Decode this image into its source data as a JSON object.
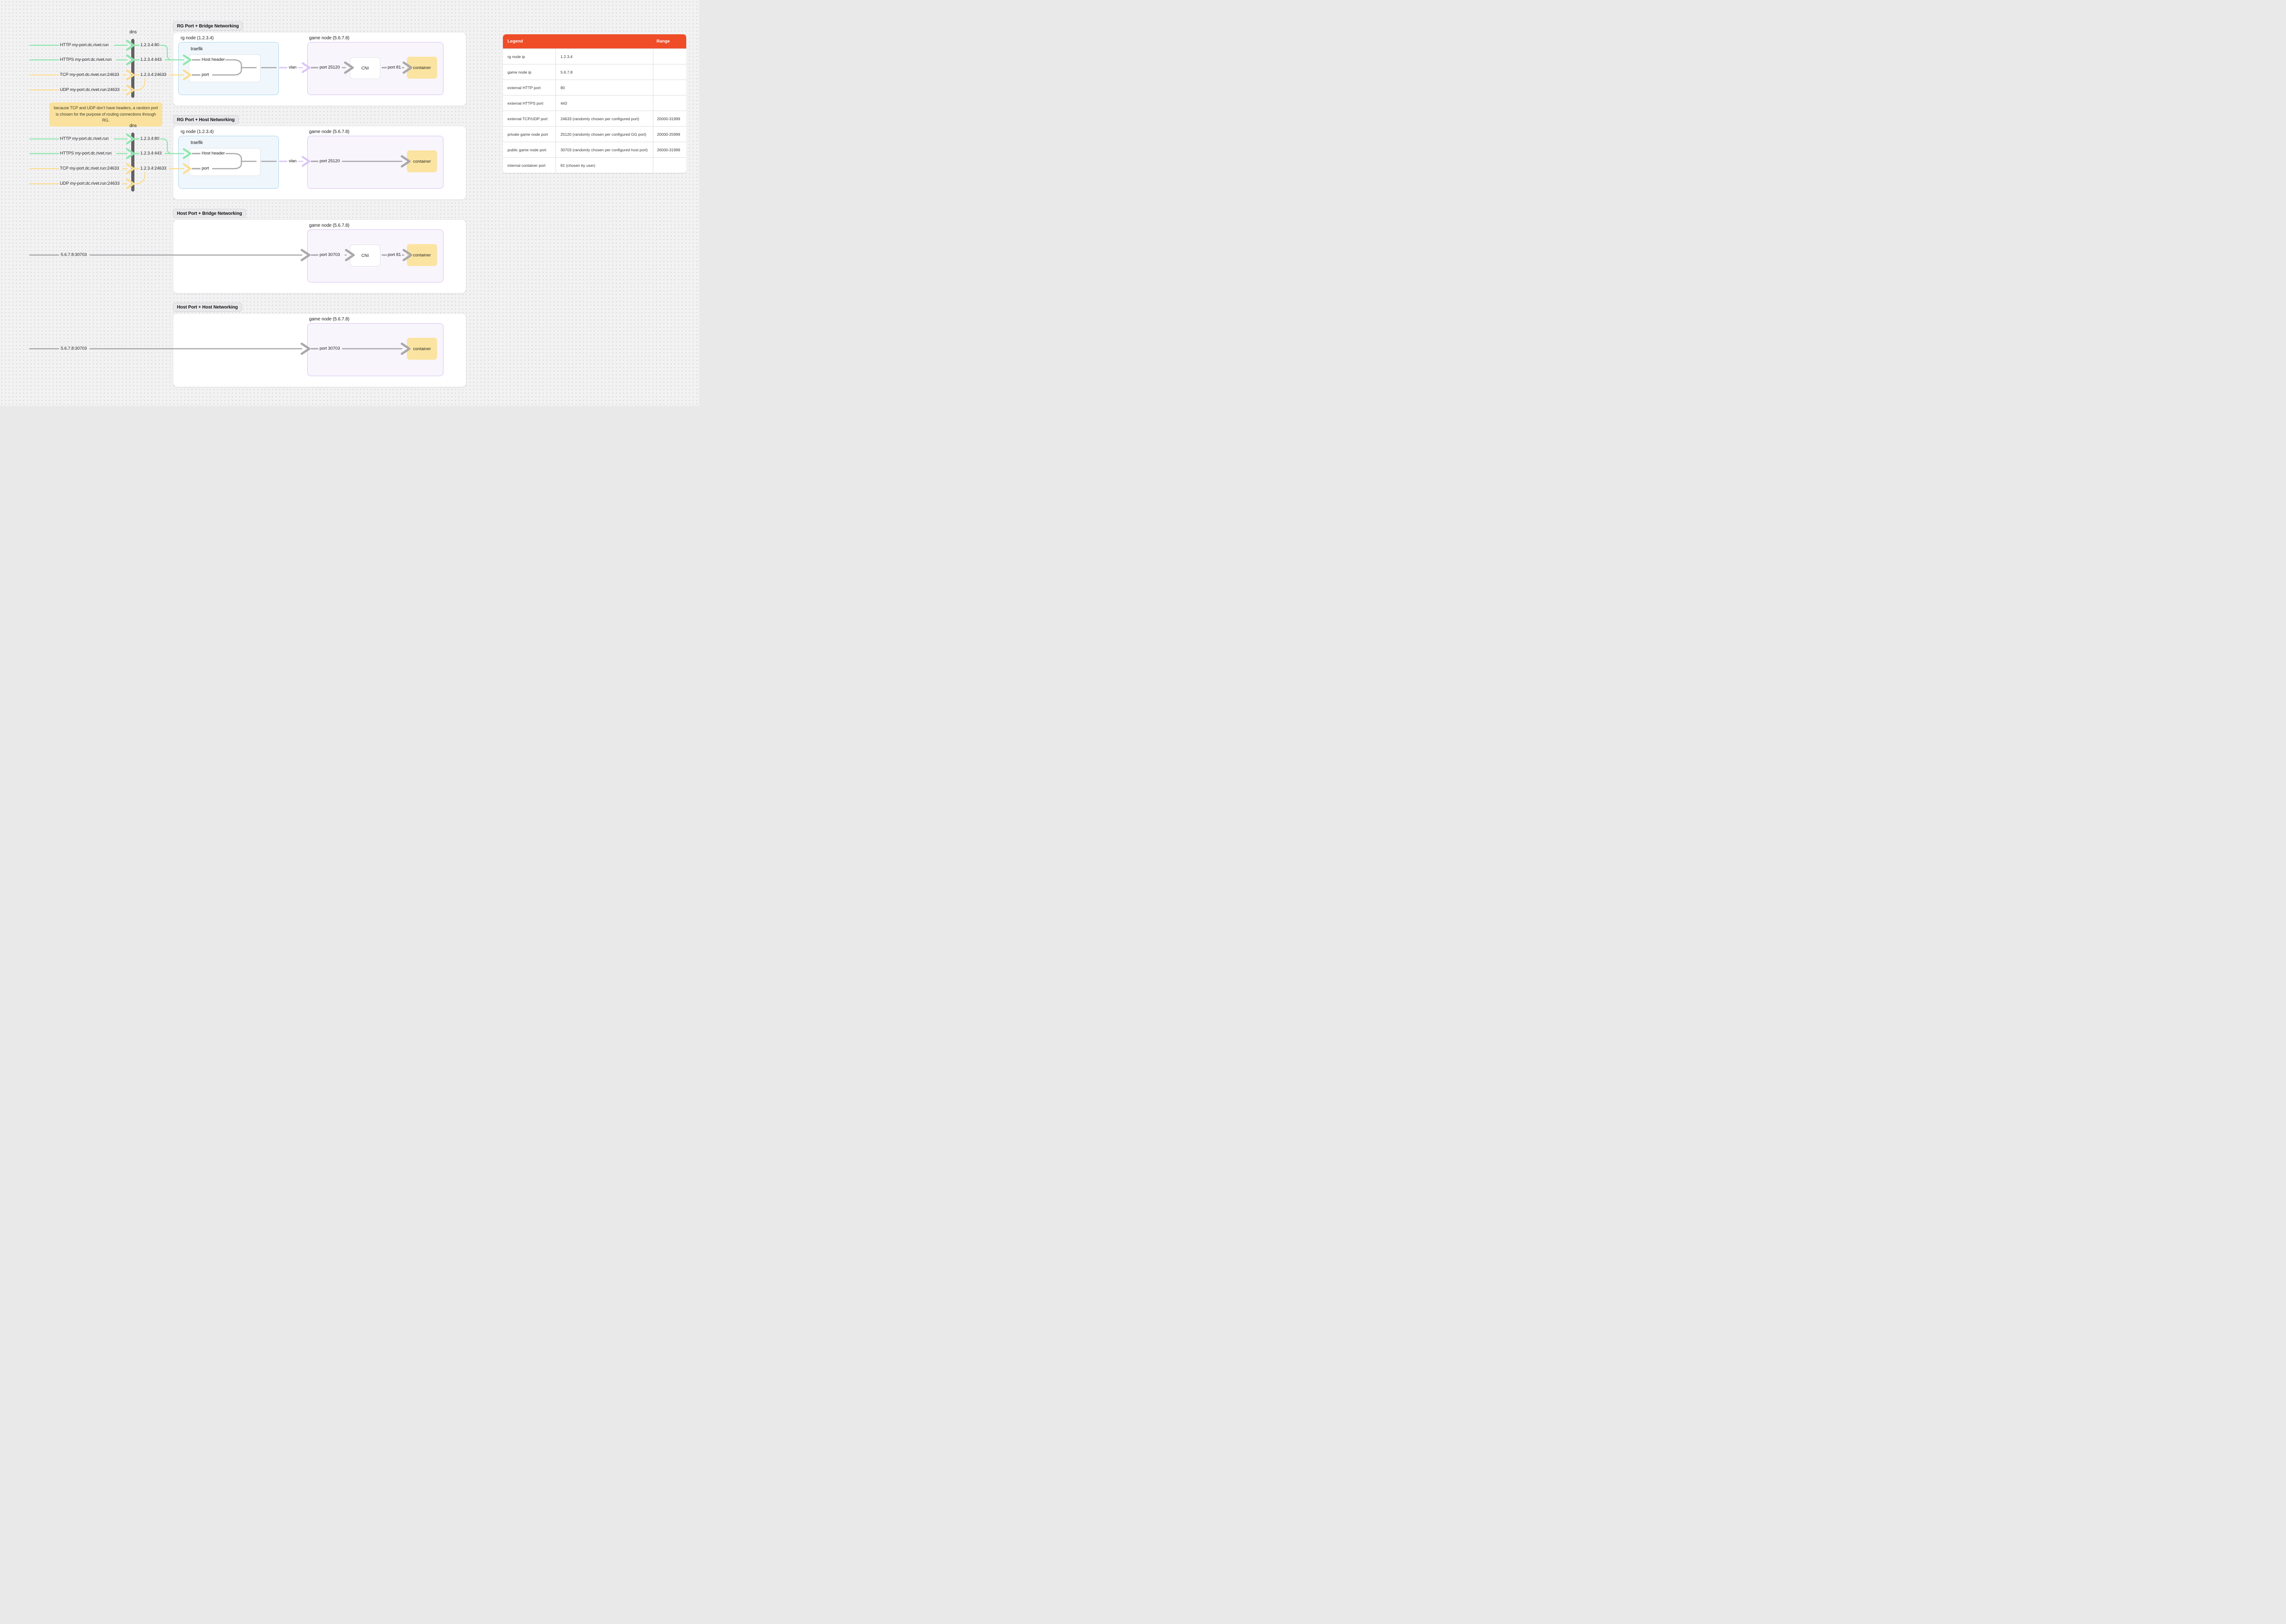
{
  "colors": {
    "background": "#F2F2F3",
    "accent_orange": "#EE4D28",
    "green_arrow": "#8FE7AE",
    "yellow_arrow": "#FBDD90",
    "purple_arrow": "#DBC6F6",
    "gray_arrow": "#A9A9AC",
    "rg_node_blue": "#A9D5F0",
    "game_node_purple": "#D8C2F2",
    "container_yellow": "#FBE4A1",
    "note_yellow": "#FAE29E"
  },
  "dns": {
    "label": "dns",
    "inputs": [
      "HTTP my-port.dc.rivet.run",
      "HTTPS my-port.dc.rivet.run",
      "TCP my-port.dc.rivet.run:24633",
      "UDP my-port.dc.rivet.run:24633"
    ],
    "outputs": [
      "1.2.3.4:80",
      "1.2.3.4:443",
      "1.2.3.4:24633"
    ]
  },
  "note": "because TCP and UDP don’t have headers, a random port is chosen for the purpose of routing connections through RG.",
  "sections": [
    {
      "title": "RG Port + Bridge Networking"
    },
    {
      "title": "RG Port + Host Networking"
    },
    {
      "title": "Host Port + Bridge Networking"
    },
    {
      "title": "Host Port + Host Networking"
    }
  ],
  "nodes": {
    "rg_node": "rg node (1.2.3.4)",
    "game_node": "game node (5.6.7.8)",
    "traefik": "traefik",
    "host_header": "Host header",
    "port": "port",
    "vlan": "vlan",
    "cni": "CNI",
    "container": "container",
    "port_private": "port 25120",
    "port_public": "port 30703",
    "port_internal": "port 81",
    "host_address": "5.6.7.8:30703"
  },
  "legend_table": {
    "headers": [
      "Legend",
      "",
      "Range"
    ],
    "rows": [
      {
        "label": "rg node ip",
        "value": "1.2.3.4",
        "range": ""
      },
      {
        "label": "game node ip",
        "value": "5.6.7.8",
        "range": ""
      },
      {
        "label": "external HTTP port",
        "value": "80",
        "range": ""
      },
      {
        "label": "external HTTPS port",
        "value": "443",
        "range": ""
      },
      {
        "label": "external TCP/UDP port",
        "value": "24633 (randomly chosen per configured port)",
        "range": "20000-31999"
      },
      {
        "label": "private game node port",
        "value": "25120 (randomly chosen per configured GG port)",
        "range": "20000-25999"
      },
      {
        "label": "public game node port",
        "value": "30703 (randomly chosen per configured host port)",
        "range": "26000-31999"
      },
      {
        "label": "internal container port",
        "value": "81 (chosen by user)",
        "range": ""
      }
    ]
  }
}
